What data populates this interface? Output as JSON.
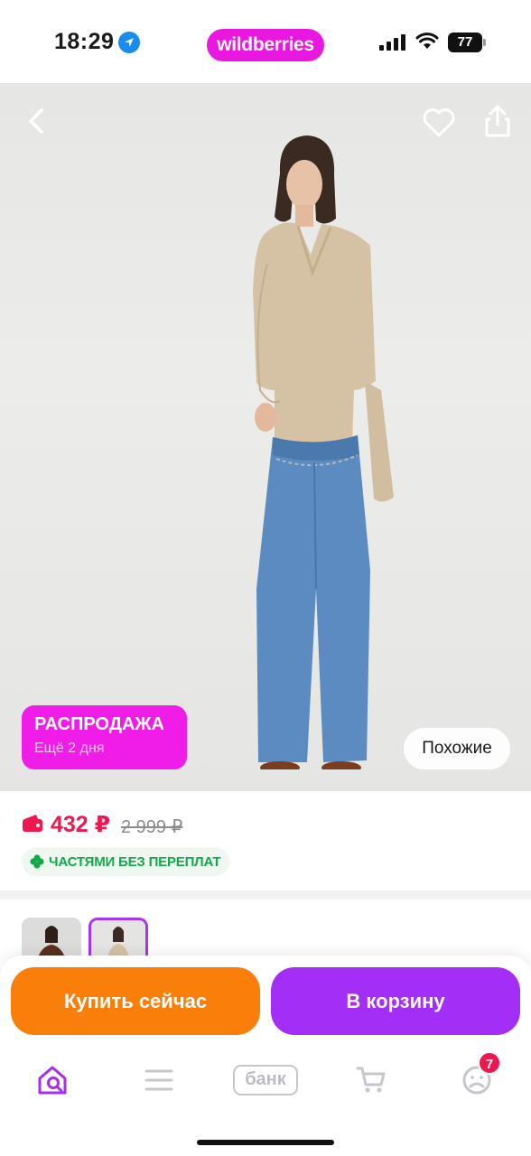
{
  "status_bar": {
    "time": "18:29",
    "battery": "77",
    "icons": [
      "location-arrow-icon",
      "signal-icon",
      "wifi-icon",
      "battery-icon"
    ]
  },
  "brand": "wildberries",
  "colors": {
    "brand_magenta": "#e917e0",
    "price_red": "#f0164e",
    "buy_orange": "#fa7e0a",
    "cart_purple": "#a32ef5",
    "installments_green": "#14a84b"
  },
  "hero": {
    "sale_badge": {
      "title": "РАСПРОДАЖА",
      "subtitle": "Ещё 2 дня"
    },
    "similar_button": "Похожие",
    "icons": [
      "back-icon",
      "heart-icon",
      "share-icon"
    ]
  },
  "price": {
    "current": "432 ₽",
    "old": "2 999 ₽",
    "installments": "ЧАСТЯМИ БЕЗ ПЕРЕПЛАТ"
  },
  "actions": {
    "buy_now": "Купить сейчас",
    "add_to_cart": "В корзину"
  },
  "tabbar": {
    "bank_label": "банк",
    "profile_badge": "7",
    "tabs": [
      "home-search-icon",
      "menu-icon",
      "bank-icon",
      "cart-icon",
      "profile-icon"
    ]
  }
}
